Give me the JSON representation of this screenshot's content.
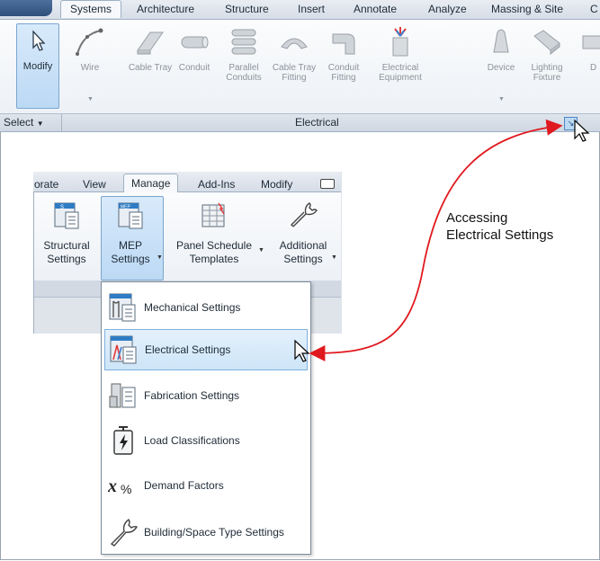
{
  "top_ribbon": {
    "tabs": [
      "Systems",
      "Architecture",
      "Structure",
      "Insert",
      "Annotate",
      "Analyze",
      "Massing & Site",
      "C"
    ],
    "active_tab": "Systems",
    "modify_label": "Modify",
    "buttons": [
      {
        "label": "Wire",
        "icon": "wire-icon"
      },
      {
        "label": "Cable Tray",
        "icon": "cable-tray-icon"
      },
      {
        "label": "Conduit",
        "icon": "conduit-icon"
      },
      {
        "label": "Parallel Conduits",
        "icon": "parallel-conduits-icon"
      },
      {
        "label": "Cable Tray Fitting",
        "icon": "cable-tray-fitting-icon"
      },
      {
        "label": "Conduit Fitting",
        "icon": "conduit-fitting-icon"
      },
      {
        "label": "Electrical Equipment",
        "icon": "electrical-equipment-icon"
      },
      {
        "label": "Device",
        "icon": "device-icon"
      },
      {
        "label": "Lighting Fixture",
        "icon": "lighting-fixture-icon"
      },
      {
        "label": "D",
        "icon": "data-device-icon"
      }
    ],
    "select_label": "Select",
    "panel_label": "Electrical",
    "launcher_glyph": "↘"
  },
  "manage_ribbon": {
    "tabs": [
      "orate",
      "View",
      "Manage",
      "Add-Ins",
      "Modify"
    ],
    "active_tab": "Manage",
    "buttons": [
      {
        "line1": "Structural",
        "line2": "Settings",
        "icon": "structural-settings-icon"
      },
      {
        "line1": "MEP",
        "line2": "Settings",
        "icon": "mep-settings-icon",
        "has_dropdown": true
      },
      {
        "line1": "Panel Schedule",
        "line2": "Templates",
        "icon": "panel-schedule-templates-icon",
        "has_dropdown": true
      },
      {
        "line1": "Additional",
        "line2": "Settings",
        "icon": "wrench-icon",
        "has_dropdown": true
      }
    ]
  },
  "mep_dropdown": {
    "items": [
      {
        "label": "Mechanical Settings",
        "icon": "mechanical-settings-icon",
        "highlighted": false
      },
      {
        "label": "Electrical Settings",
        "icon": "electrical-settings-icon",
        "highlighted": true
      },
      {
        "label": "Fabrication Settings",
        "icon": "fabrication-settings-icon",
        "highlighted": false
      },
      {
        "label": "Load Classifications",
        "icon": "load-classifications-icon",
        "highlighted": false
      },
      {
        "label": "Demand Factors",
        "icon": "demand-factors-icon",
        "highlighted": false
      },
      {
        "label": "Building/Space Type Settings",
        "icon": "building-space-type-icon",
        "highlighted": false
      }
    ]
  },
  "annotation": {
    "line1": "Accessing",
    "line2": "Electrical Settings",
    "arrow_color": "#e0191e"
  },
  "colors": {
    "highlight": "#cde5f8",
    "ribbon_bg": "#edf1f6"
  }
}
